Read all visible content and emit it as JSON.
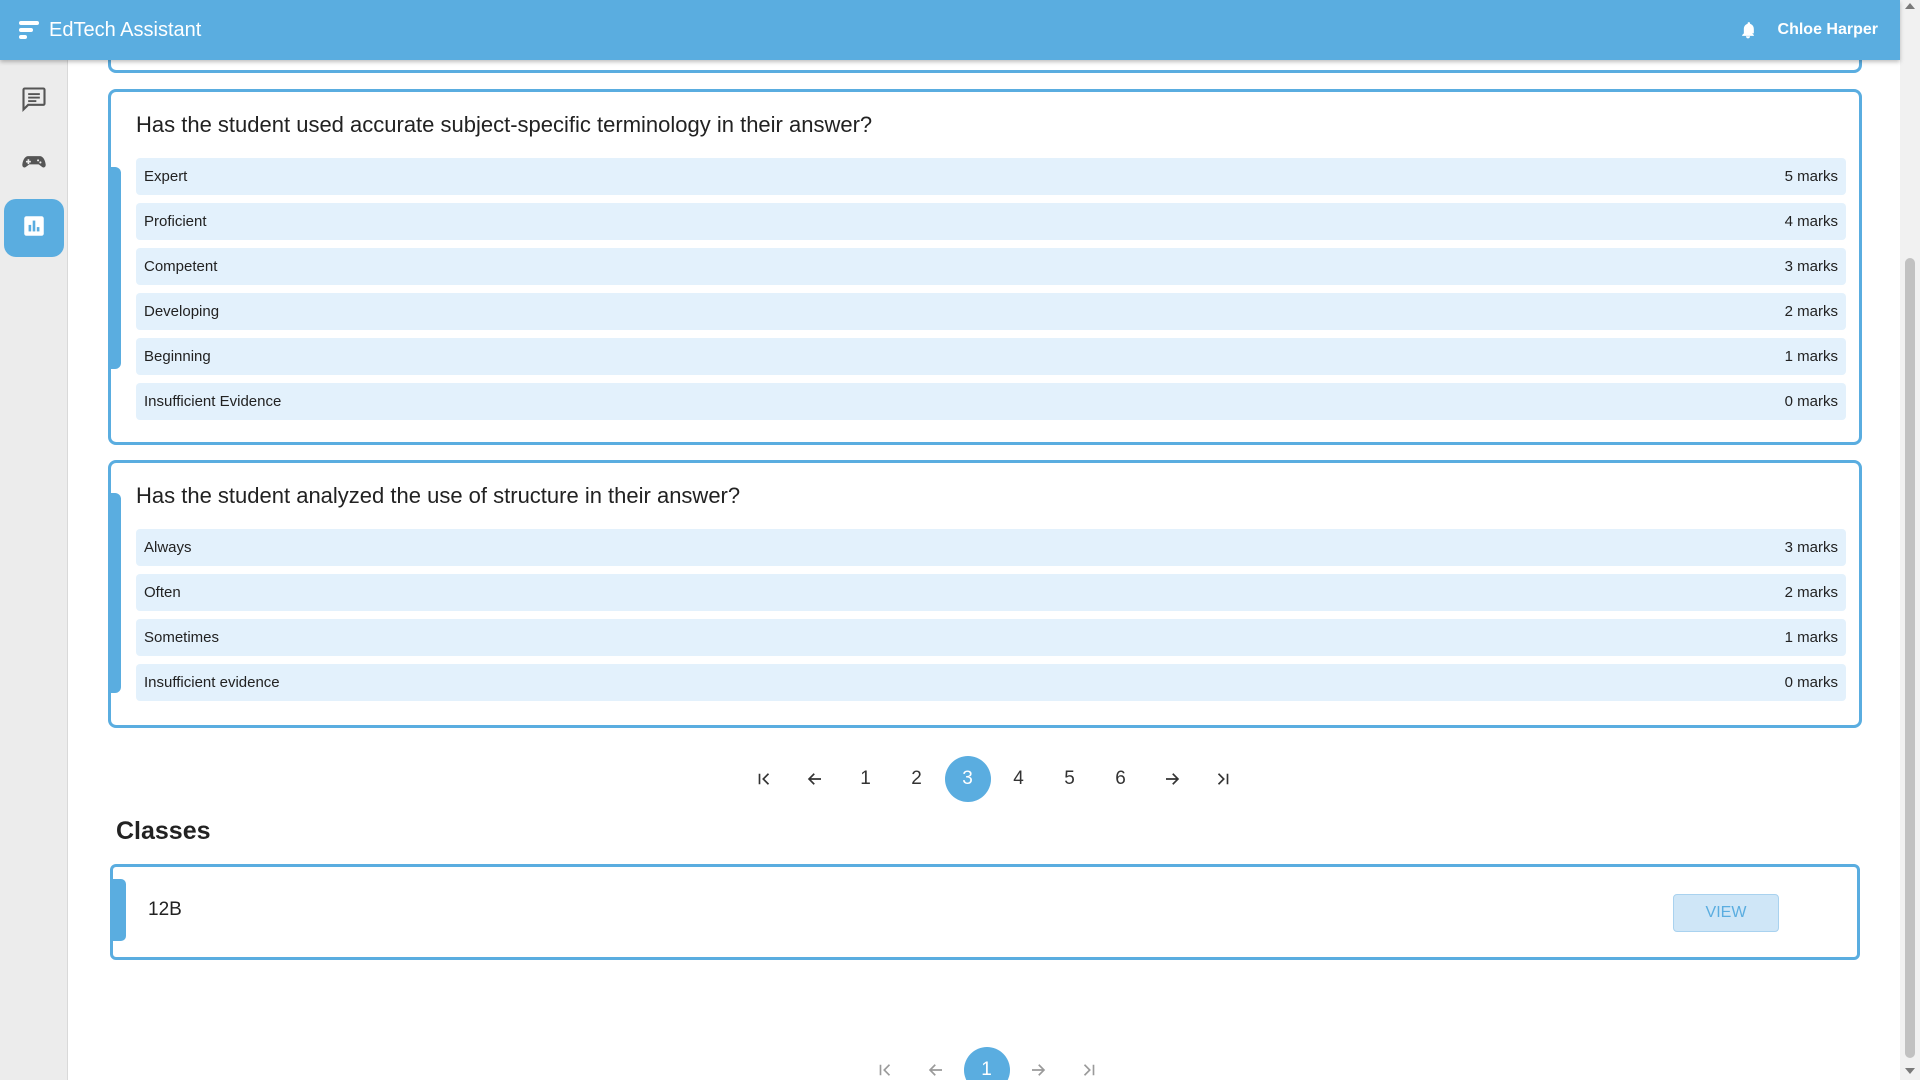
{
  "app": {
    "title": "EdTech Assistant",
    "user_name": "Chloe Harper"
  },
  "colors": {
    "accent": "#5aade0",
    "option_bg": "#e3f1fc",
    "view_button_bg": "#cfe6f7"
  },
  "sidebar": {
    "items": [
      {
        "icon": "chat-icon",
        "active": false
      },
      {
        "icon": "gamepad-icon",
        "active": false
      },
      {
        "icon": "bar-chart-icon",
        "active": true
      }
    ]
  },
  "rubric": {
    "questions": [
      {
        "text": "Has the student used accurate subject-specific terminology in their answer?",
        "options": [
          {
            "label": "Expert",
            "marks": "5 marks"
          },
          {
            "label": "Proficient",
            "marks": "4 marks"
          },
          {
            "label": "Competent",
            "marks": "3 marks"
          },
          {
            "label": "Developing",
            "marks": "2 marks"
          },
          {
            "label": "Beginning",
            "marks": "1 marks"
          },
          {
            "label": "Insufficient Evidence",
            "marks": "0 marks"
          }
        ]
      },
      {
        "text": "Has the student analyzed the use of structure in their answer?",
        "options": [
          {
            "label": "Always",
            "marks": "3 marks"
          },
          {
            "label": "Often",
            "marks": "2 marks"
          },
          {
            "label": "Sometimes",
            "marks": "1 marks"
          },
          {
            "label": "Insufficient evidence",
            "marks": "0 marks"
          }
        ]
      }
    ],
    "pagination": {
      "pages": [
        "1",
        "2",
        "3",
        "4",
        "5",
        "6"
      ],
      "current": "3"
    }
  },
  "classes": {
    "heading": "Classes",
    "items": [
      {
        "name": "12B",
        "action": "VIEW"
      }
    ],
    "pagination": {
      "pages": [
        "1"
      ],
      "current": "1"
    }
  }
}
